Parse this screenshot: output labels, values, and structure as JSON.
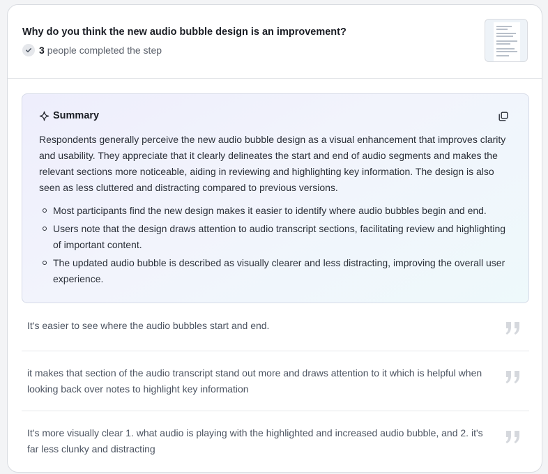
{
  "header": {
    "question": "Why do you think the new audio bubble design is an improvement?",
    "completed_count": "3",
    "completed_label": "people completed the step"
  },
  "summary": {
    "title": "Summary",
    "text": "Respondents generally perceive the new audio bubble design as a visual enhancement that improves clarity and usability. They appreciate that it clearly delineates the start and end of audio segments and makes the relevant sections more noticeable, aiding in reviewing and highlighting key information. The design is also seen as less cluttered and distracting compared to previous versions.",
    "bullets": [
      "Most participants find the new design makes it easier to identify where audio bubbles begin and end.",
      "Users note that the design draws attention to audio transcript sections, facilitating review and highlighting of important content.",
      "The updated audio bubble is described as visually clearer and less distracting, improving the overall user experience."
    ]
  },
  "responses": [
    "It's easier to see where the audio bubbles start and end.",
    "it makes that section of the audio transcript stand out more and draws attention to it which is helpful when looking back over notes to highlight key information",
    "It's more visually clear 1. what audio is playing with the highlighted and increased audio bubble, and 2. it's far less clunky and distracting"
  ],
  "icons": {
    "check": "check-icon",
    "sparkle": "sparkle-icon",
    "copy": "copy-icon",
    "quote": "quote-icon"
  },
  "colors": {
    "summary_bg_start": "#eeeefc",
    "summary_bg_end": "#eef9fb",
    "quote_mark": "#d5d8dd"
  }
}
